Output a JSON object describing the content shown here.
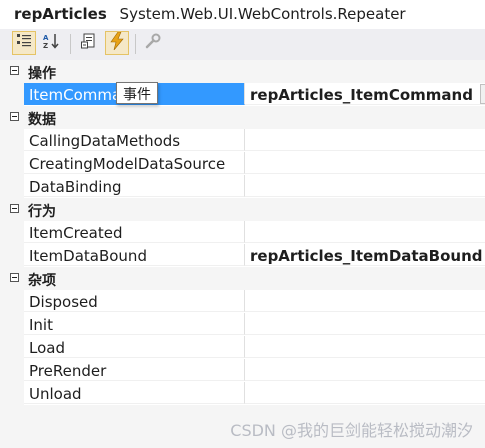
{
  "selector": {
    "object_name": "repArticles",
    "object_type": "System.Web.UI.WebControls.Repeater"
  },
  "toolbar": {
    "buttons": [
      {
        "name": "categorized-icon",
        "checked": true
      },
      {
        "name": "alphabetical-icon",
        "checked": false
      },
      {
        "name": "properties-icon",
        "checked": false
      },
      {
        "name": "events-icon",
        "checked": true
      },
      {
        "name": "property-pages-icon",
        "checked": false
      }
    ]
  },
  "categories": [
    {
      "label": "操作",
      "props": [
        {
          "name": "ItemCommand",
          "value": "repArticles_ItemCommand",
          "selected": true
        }
      ]
    },
    {
      "label": "数据",
      "props": [
        {
          "name": "CallingDataMethods",
          "value": ""
        },
        {
          "name": "CreatingModelDataSource",
          "value": ""
        },
        {
          "name": "DataBinding",
          "value": ""
        }
      ]
    },
    {
      "label": "行为",
      "props": [
        {
          "name": "ItemCreated",
          "value": ""
        },
        {
          "name": "ItemDataBound",
          "value": "repArticles_ItemDataBound"
        }
      ]
    },
    {
      "label": "杂项",
      "props": [
        {
          "name": "Disposed",
          "value": ""
        },
        {
          "name": "Init",
          "value": ""
        },
        {
          "name": "Load",
          "value": ""
        },
        {
          "name": "PreRender",
          "value": ""
        },
        {
          "name": "Unload",
          "value": ""
        }
      ]
    }
  ],
  "tooltip": "事件",
  "watermark": "CSDN @我的巨剑能轻松搅动潮汐",
  "colors": {
    "selection": "#3399ff",
    "events_icon": "#e8a317",
    "checked_button_bg": "#f5e8c7"
  }
}
